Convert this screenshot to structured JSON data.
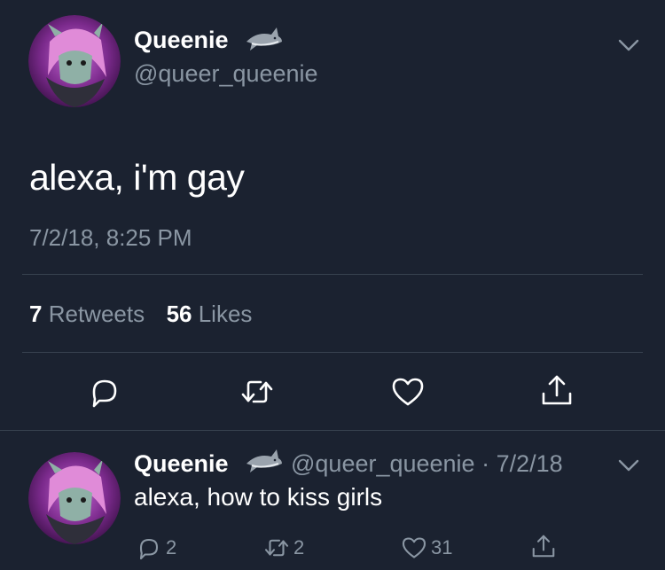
{
  "tweet": {
    "author_name": "Queenie",
    "author_handle": "@queer_queenie",
    "text": "alexa, i'm gay",
    "timestamp": "7/2/18, 8:25 PM",
    "stats": {
      "retweets_count": "7",
      "retweets_label": "Retweets",
      "likes_count": "56",
      "likes_label": "Likes"
    }
  },
  "reply": {
    "author_name": "Queenie",
    "meta": "@queer_queenie · 7/2/18",
    "text": "alexa, how to kiss girls",
    "reply_count": "2",
    "retweet_count": "2",
    "like_count": "31"
  },
  "icons": {
    "name_emoji": "shark-icon",
    "menu": "chevron-down-icon",
    "reply": "reply-icon",
    "retweet": "retweet-icon",
    "like": "heart-icon",
    "share": "share-icon"
  },
  "colors": {
    "background": "#1b2230",
    "secondary_text": "#8a96a3",
    "divider": "#38424f"
  }
}
